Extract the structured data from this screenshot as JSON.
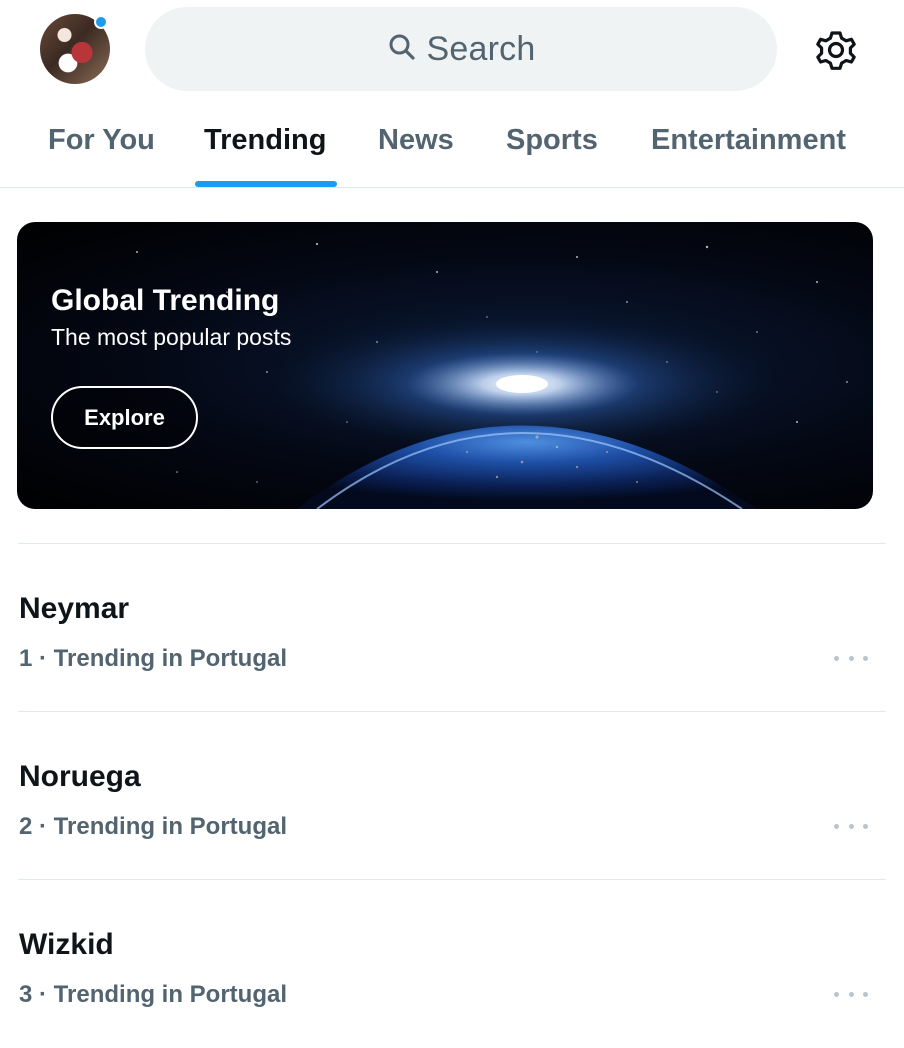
{
  "header": {
    "search_placeholder": "Search",
    "avatar_icon": "profile-avatar",
    "settings_icon": "gear-icon",
    "search_icon": "search-icon"
  },
  "tabs": [
    {
      "label": "For You",
      "active": false
    },
    {
      "label": "Trending",
      "active": true
    },
    {
      "label": "News",
      "active": false
    },
    {
      "label": "Sports",
      "active": false
    },
    {
      "label": "Entertainment",
      "active": false
    }
  ],
  "banner": {
    "title": "Global Trending",
    "subtitle": "The most popular posts",
    "button_label": "Explore"
  },
  "trends": [
    {
      "name": "Neymar",
      "meta": "1 · Trending in Portugal"
    },
    {
      "name": "Noruega",
      "meta": "2 · Trending in Portugal"
    },
    {
      "name": "Wizkid",
      "meta": "3 · Trending in Portugal"
    }
  ],
  "colors": {
    "accent": "#1d9bf0",
    "text_primary": "#0f1419",
    "text_secondary": "#536471",
    "search_bg": "#eff3f4"
  }
}
